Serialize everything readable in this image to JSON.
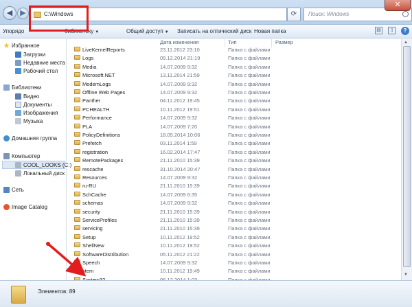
{
  "address": {
    "path": "C:\\Windows"
  },
  "search": {
    "placeholder": "Поиск: Windows"
  },
  "toolbar": {
    "organize": "Упорядо",
    "library": "библиотеку",
    "share": "Общий доступ",
    "burn": "Записать на оптический диск",
    "new_folder": "Новая папка"
  },
  "nav": {
    "favorites": "Избранное",
    "downloads": "Загрузки",
    "recent": "Недавние места",
    "desktop": "Рабочий стол",
    "libraries": "Библиотеки",
    "video": "Видео",
    "documents": "Документы",
    "images": "Изображения",
    "music": "Музыка",
    "homegroup": "Домашняя группа",
    "computer": "Компьютер",
    "drive_c": "COOL_LOOKS (C:)",
    "drive_d": "Локальный диск (D",
    "network": "Сеть",
    "image_catalog": "Image Catalog"
  },
  "columns": {
    "modified": "Дата изменения",
    "type": "Тип",
    "size": "Размер"
  },
  "files": [
    {
      "name": "LiveKernelReports",
      "date": "23.11.2012 23:10",
      "type": "Папка с файлами"
    },
    {
      "name": "Logs",
      "date": "09.12.2014 21:19",
      "type": "Папка с файлами"
    },
    {
      "name": "Media",
      "date": "14.07.2009 9:32",
      "type": "Папка с файлами"
    },
    {
      "name": "Microsoft.NET",
      "date": "13.11.2014 21:59",
      "type": "Папка с файлами"
    },
    {
      "name": "ModemLogs",
      "date": "14.07.2009 9:32",
      "type": "Папка с файлами"
    },
    {
      "name": "Offline Web Pages",
      "date": "14.07.2009 9:32",
      "type": "Папка с файлами"
    },
    {
      "name": "Panther",
      "date": "04.11.2012 19:45",
      "type": "Папка с файлами"
    },
    {
      "name": "PCHEALTH",
      "date": "10.11.2012 19:51",
      "type": "Папка с файлами"
    },
    {
      "name": "Performance",
      "date": "14.07.2009 9:32",
      "type": "Папка с файлами"
    },
    {
      "name": "PLA",
      "date": "14.07.2009 7:20",
      "type": "Папка с файлами"
    },
    {
      "name": "PolicyDefinitions",
      "date": "18.05.2014 10:06",
      "type": "Папка с файлами"
    },
    {
      "name": "Prefetch",
      "date": "03.11.2014 1:59",
      "type": "Папка с файлами"
    },
    {
      "name": "registration",
      "date": "16.02.2014 17:47",
      "type": "Папка с файлами"
    },
    {
      "name": "RemotePackages",
      "date": "21.11.2010 15:39",
      "type": "Папка с файлами"
    },
    {
      "name": "rescache",
      "date": "31.10.2014 20:47",
      "type": "Папка с файлами"
    },
    {
      "name": "Resources",
      "date": "14.07.2009 9:32",
      "type": "Папка с файлами"
    },
    {
      "name": "ru-RU",
      "date": "21.11.2010 15:39",
      "type": "Папка с файлами"
    },
    {
      "name": "SchCache",
      "date": "14.07.2009 6:35",
      "type": "Папка с файлами"
    },
    {
      "name": "schemas",
      "date": "14.07.2009 9:32",
      "type": "Папка с файлами"
    },
    {
      "name": "security",
      "date": "21.11.2010 15:39",
      "type": "Папка с файлами"
    },
    {
      "name": "ServiceProfiles",
      "date": "21.11.2010 15:39",
      "type": "Папка с файлами"
    },
    {
      "name": "servicing",
      "date": "21.11.2010 15:39",
      "type": "Папка с файлами"
    },
    {
      "name": "Setup",
      "date": "10.11.2012 19:52",
      "type": "Папка с файлами"
    },
    {
      "name": "ShellNew",
      "date": "10.11.2012 19:52",
      "type": "Папка с файлами"
    },
    {
      "name": "SoftwareDistribution",
      "date": "05.11.2012 21:22",
      "type": "Папка с файлами"
    },
    {
      "name": "Speech",
      "date": "14.07.2009 9:32",
      "type": "Папка с файлами"
    },
    {
      "name": "stem",
      "date": "10.11.2012 19:49",
      "type": "Папка с файлами"
    },
    {
      "name": "System32",
      "date": "06.12.2014 1:03",
      "type": "Папка с файлами"
    }
  ],
  "status": {
    "count": "Элементов: 89"
  },
  "colors": {
    "highlight": "#e11d1d",
    "folder": "#e8c66a",
    "chrome": "#cfe0f3"
  }
}
